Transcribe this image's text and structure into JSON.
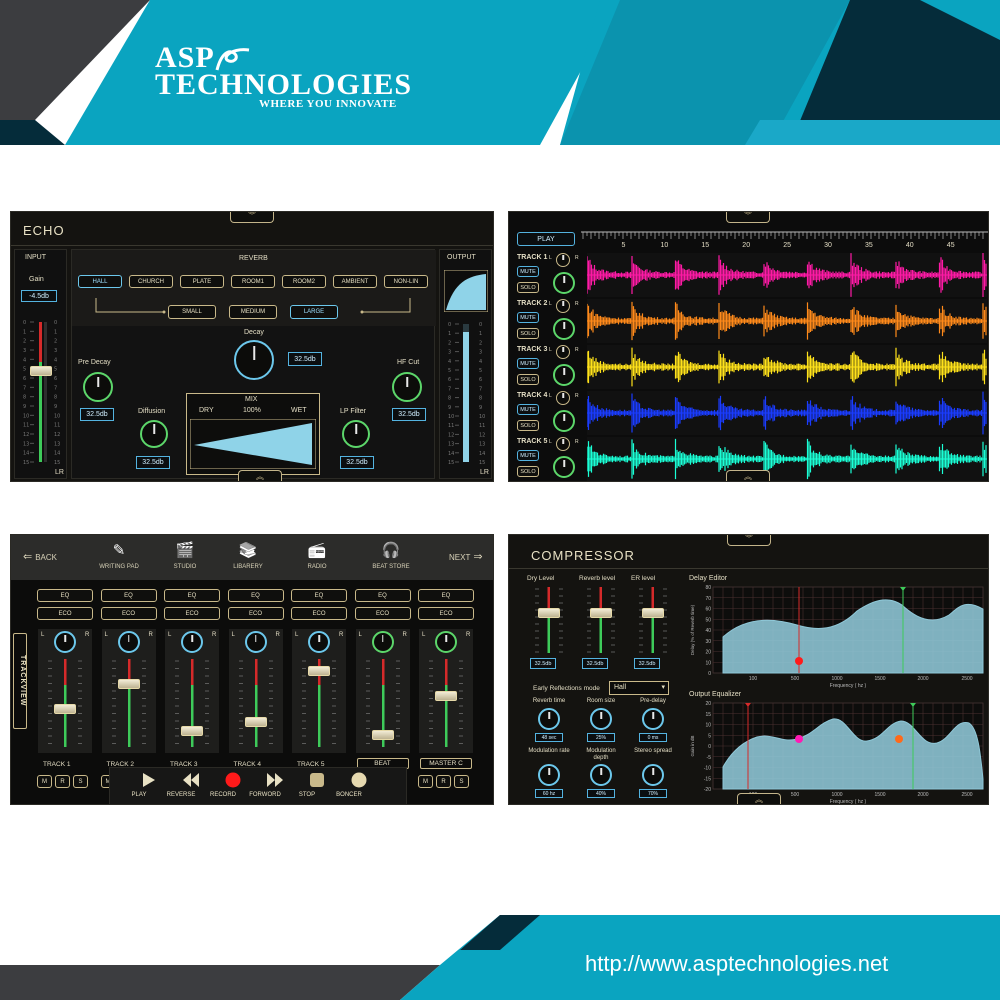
{
  "brand": {
    "name_line1": "ASP",
    "name_line2": "TECHNOLOGIES",
    "tagline": "WHERE YOU INNOVATE",
    "colors": {
      "teal": "#0aa4c0",
      "dark": "#3c3d40",
      "navy": "#052c3a"
    }
  },
  "footer": {
    "url": "http://www.asptechnologies.net"
  },
  "echo": {
    "title": "ECHO",
    "input": {
      "label": "INPUT",
      "gain_label": "Gain",
      "gain_value": "-4.5db",
      "lr": "LR",
      "level": 0.35
    },
    "output": {
      "label": "OUTPUT",
      "lr": "LR"
    },
    "reverb": {
      "label": "REVERB",
      "types": [
        "HALL",
        "CHURCH",
        "PLATE",
        "ROOM1",
        "ROOM2",
        "AMBIENT",
        "NON-LIN"
      ],
      "selected_type": "HALL",
      "sizes": [
        "SMALL",
        "MEDIUM",
        "LARGE"
      ],
      "selected_size": "LARGE"
    },
    "decay": {
      "label": "Decay",
      "value": "32.5db"
    },
    "pre_decay": {
      "label": "Pre Decay",
      "value": "32.5db"
    },
    "hf_cut": {
      "label": "HF Cut",
      "value": "32.5db"
    },
    "diffusion": {
      "label": "Diffusion",
      "value": "32.5db"
    },
    "lp_filter": {
      "label": "LP Filter",
      "value": "32.5db"
    },
    "mix": {
      "label": "MIX",
      "dry": "DRY",
      "pct": "100%",
      "wet": "WET"
    }
  },
  "tracks": {
    "play_label": "PLAY",
    "ruler_labels": [
      "5",
      "10",
      "15",
      "20",
      "25",
      "30",
      "35",
      "40",
      "45"
    ],
    "items": [
      {
        "name": "TRACK 1",
        "mute": "MUTE",
        "solo": "SOLO",
        "color": "#ff1aa6"
      },
      {
        "name": "TRACK 2",
        "mute": "MUTE",
        "solo": "SOLO",
        "color": "#ff8a1a"
      },
      {
        "name": "TRACK 3",
        "mute": "MUTE",
        "solo": "SOLO",
        "color": "#ffe21a"
      },
      {
        "name": "TRACK 4",
        "mute": "MUTE",
        "solo": "SOLO",
        "color": "#1a3cff"
      },
      {
        "name": "TRACK 5",
        "mute": "MUTE",
        "solo": "SOLO",
        "color": "#1affd6"
      }
    ],
    "lr": {
      "l": "L",
      "r": "R"
    }
  },
  "mixer": {
    "back": "BACK",
    "next": "NEXT",
    "nav": [
      {
        "label": "WRITING PAD",
        "icon": "writing-pad-icon"
      },
      {
        "label": "STUDIO",
        "icon": "clapperboard-icon"
      },
      {
        "label": "LIBARERY",
        "icon": "library-icon"
      },
      {
        "label": "RADIO",
        "icon": "radio-icon"
      },
      {
        "label": "BEAT STORE",
        "icon": "headphones-icon"
      }
    ],
    "trackview": "TRACKVIEW",
    "eq": "EQ",
    "eco": "ECO",
    "channels": [
      {
        "name": "TRACK 1",
        "level": 0.45
      },
      {
        "name": "TRACK 2",
        "level": 0.75
      },
      {
        "name": "TRACK 3",
        "level": 0.2
      },
      {
        "name": "TRACK 4",
        "level": 0.3
      },
      {
        "name": "TRACK 5",
        "level": 0.9
      },
      {
        "name": "BEAT",
        "level": 0.15
      },
      {
        "name": "MASTER C",
        "level": 0.6
      }
    ],
    "mrs": [
      "M",
      "R",
      "S"
    ],
    "transport": [
      {
        "label": "PLAY",
        "icon": "play-icon"
      },
      {
        "label": "REVERSE",
        "icon": "rewind-icon"
      },
      {
        "label": "RECORD",
        "icon": "record-icon"
      },
      {
        "label": "FORWORD",
        "icon": "fast-forward-icon"
      },
      {
        "label": "STOP",
        "icon": "stop-icon"
      },
      {
        "label": "BONCER",
        "icon": "bouncer-icon"
      }
    ]
  },
  "compressor": {
    "title": "COMPRESSOR",
    "sliders": [
      {
        "label": "Dry Level",
        "value": "32.5db"
      },
      {
        "label": "Reverb level",
        "value": "32.5db"
      },
      {
        "label": "ER level",
        "value": "32.5db"
      }
    ],
    "er_mode_label": "Early Reflections mode",
    "er_mode_value": "Hall",
    "knobs": [
      {
        "label": "Reverb time",
        "value": "48 sec"
      },
      {
        "label": "Room size",
        "value": "25%"
      },
      {
        "label": "Pre-delay",
        "value": "0 ms"
      },
      {
        "label": "Modulation rate",
        "value": "60 hz"
      },
      {
        "label": "Modulation depth",
        "value": "40%"
      },
      {
        "label": "Stereo spread",
        "value": "70%"
      }
    ],
    "delay_editor": {
      "title": "Delay Editor",
      "ylabel": "Delay (% of Reverb time)",
      "xlabel": "Frequency ( hz )",
      "xticks": [
        "100",
        "500",
        "1000",
        "1500",
        "2000",
        "2500"
      ],
      "yticks": [
        "80",
        "70",
        "60",
        "50",
        "40",
        "30",
        "20",
        "10",
        "0"
      ]
    },
    "output_eq": {
      "title": "Output Equalizer",
      "ylabel": "Gain in dB",
      "xlabel": "Frequency ( hz )",
      "xticks": [
        "100",
        "500",
        "1000",
        "1500",
        "2000",
        "2500"
      ],
      "yticks": [
        "20",
        "15",
        "10",
        "5",
        "0",
        "-5",
        "-10",
        "-15",
        "-20"
      ]
    }
  }
}
